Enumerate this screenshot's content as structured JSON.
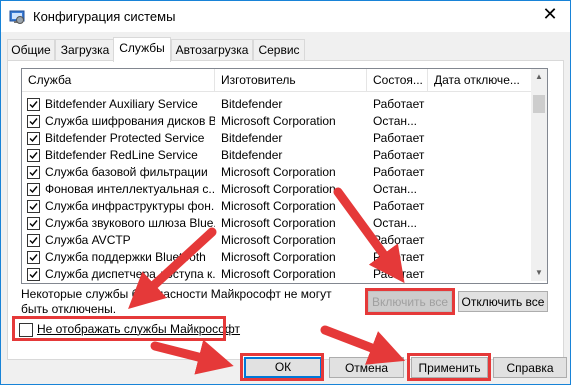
{
  "window": {
    "title": "Конфигурация системы",
    "close_icon": "close-icon"
  },
  "tabs": [
    {
      "label": "Общие",
      "active": false
    },
    {
      "label": "Загрузка",
      "active": false
    },
    {
      "label": "Службы",
      "active": true
    },
    {
      "label": "Автозагрузка",
      "active": false
    },
    {
      "label": "Сервис",
      "active": false
    }
  ],
  "table": {
    "columns": [
      "Служба",
      "Изготовитель",
      "Состоя...",
      "Дата отключе..."
    ],
    "rows": [
      {
        "checked": true,
        "name": "Bitdefender Auxiliary Service",
        "vendor": "Bitdefender",
        "status": "Работает"
      },
      {
        "checked": true,
        "name": "Служба шифрования дисков Bi...",
        "vendor": "Microsoft Corporation",
        "status": "Остан..."
      },
      {
        "checked": true,
        "name": "Bitdefender Protected Service",
        "vendor": "Bitdefender",
        "status": "Работает"
      },
      {
        "checked": true,
        "name": "Bitdefender RedLine Service",
        "vendor": "Bitdefender",
        "status": "Работает"
      },
      {
        "checked": true,
        "name": "Служба базовой фильтрации",
        "vendor": "Microsoft Corporation",
        "status": "Работает"
      },
      {
        "checked": true,
        "name": "Фоновая интеллектуальная с...",
        "vendor": "Microsoft Corporation",
        "status": "Остан..."
      },
      {
        "checked": true,
        "name": "Служба инфраструктуры фон...",
        "vendor": "Microsoft Corporation",
        "status": "Работает"
      },
      {
        "checked": true,
        "name": "Служба звукового шлюза Blue...",
        "vendor": "Microsoft Corporation",
        "status": "Остан..."
      },
      {
        "checked": true,
        "name": "Служба AVCTP",
        "vendor": "Microsoft Corporation",
        "status": "Работает"
      },
      {
        "checked": true,
        "name": "Служба поддержки Bluetooth",
        "vendor": "Microsoft Corporation",
        "status": "Работает"
      },
      {
        "checked": true,
        "name": "Служба диспетчера доступа к...",
        "vendor": "Microsoft Corporation",
        "status": "Работает"
      }
    ]
  },
  "note": "Некоторые службы безопасности Майкрософт не могут быть отключены.",
  "buttons": {
    "enable_all": "Включить все",
    "disable_all": "Отключить все",
    "ok": "ОК",
    "cancel": "Отмена",
    "apply": "Применить",
    "help": "Справка"
  },
  "hide_ms_checkbox": {
    "label": "Не отображать службы Майкрософт",
    "checked": false
  },
  "annotation_color": "#e53939"
}
